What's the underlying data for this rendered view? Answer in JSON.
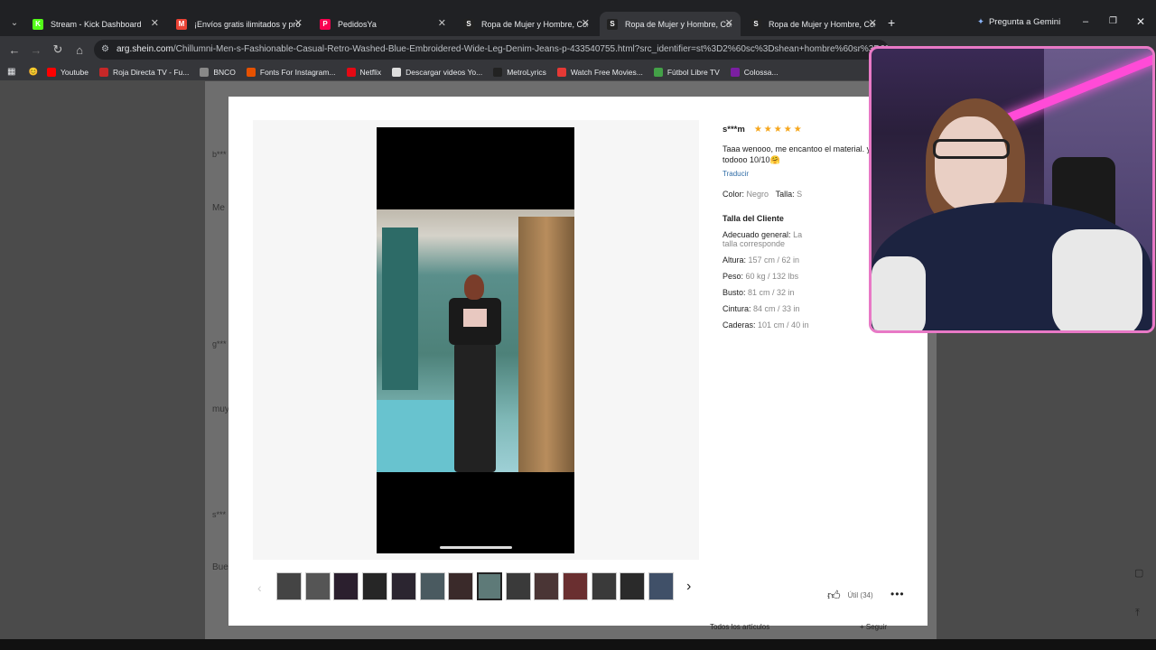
{
  "tabs": [
    {
      "title": "Stream - Kick Dashboard",
      "icon": "K",
      "color": "#53fc18",
      "active": false
    },
    {
      "title": "¡Envíos gratis ilimitados y promo",
      "icon": "M",
      "color": "#ea4335",
      "active": false
    },
    {
      "title": "PedidosYa",
      "icon": "P",
      "color": "#fa0050",
      "active": false
    },
    {
      "title": "Ropa de Mujer y Hombre, Com",
      "icon": "S",
      "color": "#222222",
      "active": false
    },
    {
      "title": "Ropa de Mujer y Hombre, Com",
      "icon": "S",
      "color": "#222222",
      "active": true
    },
    {
      "title": "Ropa de Mujer y Hombre, Com",
      "icon": "S",
      "color": "#222222",
      "active": false
    }
  ],
  "gemini": "Pregunta a Gemini",
  "url_host": "arg.shein.com",
  "url_path": "/Chillumni-Men-s-Fashionable-Casual-Retro-Washed-Blue-Embroidered-Wide-Leg-Denim-Jeans-p-433540755.html?src_identifier=st%3D2%60sc%3Dshean+hombre%60sr%3D0%60ps%3D1",
  "bookmarks": [
    {
      "label": "Youtube",
      "color": "#ff0000"
    },
    {
      "label": "Roja Directa TV - Fu...",
      "color": "#c62828"
    },
    {
      "label": "BNCO",
      "color": "#888888"
    },
    {
      "label": "Fonts For Instagram...",
      "color": "#e65100"
    },
    {
      "label": "Netflix",
      "color": "#e50914"
    },
    {
      "label": "Descargar videos Yo...",
      "color": "#dddddd"
    },
    {
      "label": "MetroLyrics",
      "color": "#222222"
    },
    {
      "label": "Watch Free Movies...",
      "color": "#e53935"
    },
    {
      "label": "Fútbol Libre TV",
      "color": "#43a047"
    },
    {
      "label": "Colossa...",
      "color": "#7b1fa2"
    }
  ],
  "review": {
    "user": "s***m",
    "stars": "★★★★★",
    "text": "Taaa wenooo, me encantoo el material. y todooo 10/10🤗",
    "translate": "Traducir",
    "color_label": "Color:",
    "color_value": "Negro",
    "size_label": "Talla:",
    "size_value": "S",
    "size_heading": "Talla del Cliente",
    "fit_label": "Adecuado general:",
    "fit_value": "La talla corresponde",
    "height_label": "Altura:",
    "height_value": "157 cm / 62 in",
    "weight_label": "Peso:",
    "weight_value": "60 kg / 132 lbs",
    "bust_label": "Busto:",
    "bust_value": "81 cm / 32 in",
    "waist_label": "Cintura:",
    "waist_value": "84 cm / 33 in",
    "hips_label": "Caderas:",
    "hips_value": "101 cm / 40 in"
  },
  "helpful": "Útil (34)",
  "more": "•••",
  "thumbnails": [
    "#444444",
    "#555555",
    "#2b1f2e",
    "#262626",
    "#2b2530",
    "#4a5a60",
    "#3a2a2a",
    "#5e7a78",
    "#3a3a3a",
    "#4a3535",
    "#6a2f30",
    "#3a3a3a",
    "#2a2a2a",
    "#405068"
  ],
  "background": {
    "review1_user": "b***",
    "review1_text": "Me",
    "review2_user": "g***",
    "review2_text": "muy",
    "review3_user": "s***",
    "review3_text": "Bue",
    "footer_left": "Todos los artículos",
    "footer_right": "+ Seguir"
  }
}
